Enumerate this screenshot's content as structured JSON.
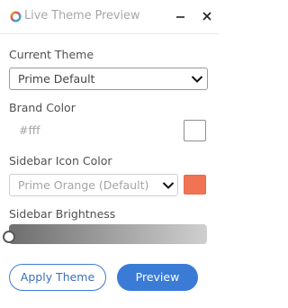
{
  "window": {
    "title": "Live Theme Preview",
    "logo_icon": "color-wheel-icon",
    "minimize_icon": "minimize-icon",
    "close_icon": "close-icon"
  },
  "current_theme": {
    "label": "Current Theme",
    "value": "Prime Default",
    "icon": "chevron-down-icon"
  },
  "brand_color": {
    "label": "Brand Color",
    "value": "#fff",
    "swatch_color": "#ffffff"
  },
  "sidebar_icon_color": {
    "label": "Sidebar Icon Color",
    "value": "Prime Orange (Default)",
    "icon": "chevron-down-icon",
    "swatch_color": "#f07353"
  },
  "sidebar_brightness": {
    "label": "Sidebar Brightness",
    "level": 0
  },
  "buttons": {
    "apply": "Apply Theme",
    "preview": "Preview"
  },
  "colors": {
    "accent": "#3a7bd5",
    "orange": "#f07353"
  }
}
